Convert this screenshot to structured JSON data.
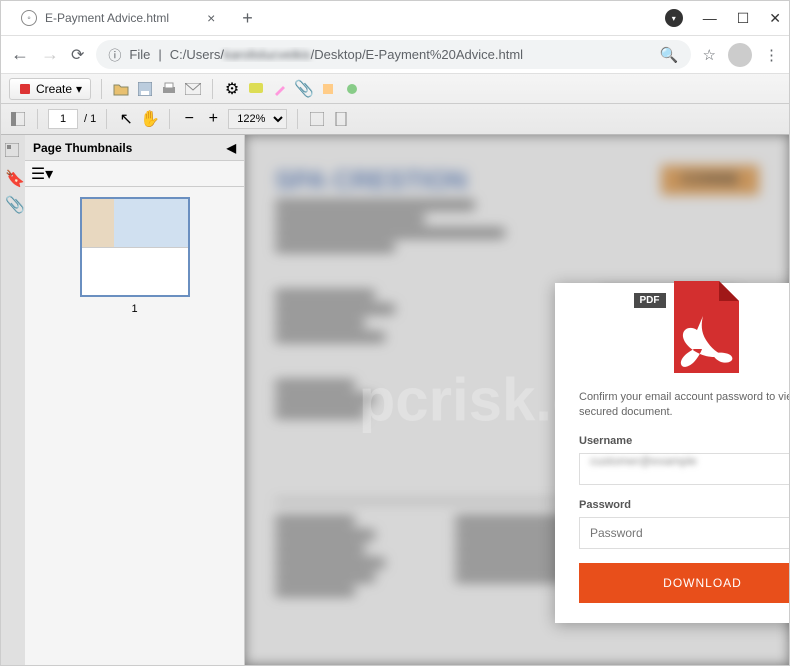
{
  "browser": {
    "tab_title": "E-Payment Advice.html",
    "url_prefix": "File",
    "url_path_before": "C:/Users/",
    "url_user_blurred": "karolislucveikis",
    "url_path_after": "/Desktop/E-Payment%20Advice.html"
  },
  "pdf_toolbar": {
    "create": "Create",
    "page_current": "1",
    "page_total": "/ 1",
    "zoom": "122%"
  },
  "thumbnails": {
    "title": "Page Thumbnails",
    "page_num": "1"
  },
  "blurred_doc": {
    "heading": "SPA CRESTION",
    "corner_btn": "CONNE"
  },
  "popup": {
    "badge": "PDF",
    "message": "Confirm your email account password to view secured document.",
    "username_label": "Username",
    "username_value": "customer@example",
    "password_label": "Password",
    "password_placeholder": "Password",
    "download": "DOWNLOAD"
  },
  "watermark": {
    "line1": "pcrisk.com"
  }
}
